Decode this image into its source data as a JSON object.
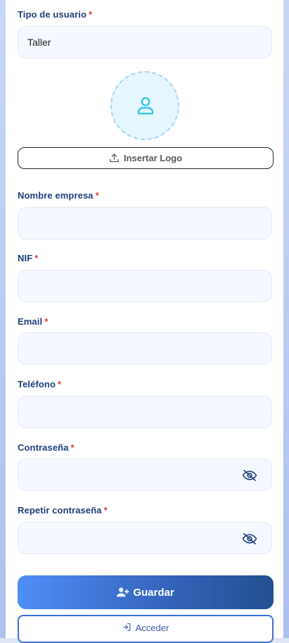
{
  "form": {
    "user_type": {
      "label": "Tipo de usuario",
      "required_mark": "*",
      "value": "Taller"
    },
    "logo_button_label": "Insertar Logo",
    "company_name": {
      "label": "Nombre empresa",
      "required_mark": "*",
      "value": ""
    },
    "nif": {
      "label": "NIF",
      "required_mark": "*",
      "value": ""
    },
    "email": {
      "label": "Email",
      "required_mark": "*",
      "value": ""
    },
    "phone": {
      "label": "Teléfono",
      "required_mark": "*",
      "value": ""
    },
    "password": {
      "label": "Contraseña",
      "required_mark": "*",
      "value": ""
    },
    "password_repeat": {
      "label": "Repetir contraseña",
      "required_mark": "*",
      "value": ""
    },
    "save_label": "Guardar",
    "access_label": "Acceder"
  },
  "icons": {
    "avatar": "user-icon",
    "upload": "upload-icon",
    "visibility": "eye-off-icon",
    "save": "user-plus-icon",
    "access": "login-icon"
  },
  "colors": {
    "label": "#1f3f7a",
    "required": "#e23b3b",
    "field_bg": "#f5f9ff",
    "avatar_accent": "#29c6e8",
    "save_gradient_start": "#4f8ef7",
    "save_gradient_end": "#23508f",
    "access_border": "#3b6fd4"
  }
}
